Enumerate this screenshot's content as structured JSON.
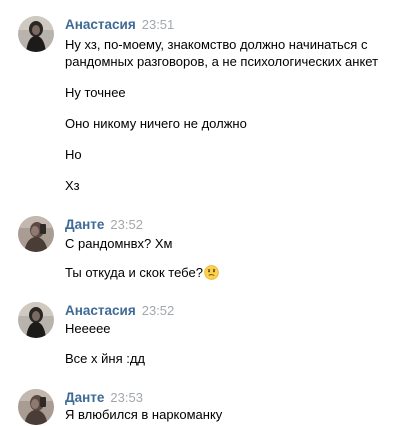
{
  "messages": [
    {
      "author": "Анастасия",
      "time": "23:51",
      "lines": [
        "Ну хз, по-моему, знакомство должно начинаться с",
        "рандомных разговоров, а не психологических анкет",
        "Ну точнее",
        "Оно никому ничего не должно",
        "Но",
        "Хз"
      ]
    },
    {
      "author": "Данте",
      "time": "23:52",
      "lines": [
        "С рандомнвх? Хм",
        "Ты откуда и скок тебе?"
      ],
      "emoji_icon": "confused-face-emoji-icon"
    },
    {
      "author": "Анастасия",
      "time": "23:52",
      "lines": [
        "Неееее",
        "Все х  йня :дд"
      ]
    },
    {
      "author": "Данте",
      "time": "23:53",
      "lines": [
        "Я влюбился в наркоманку"
      ]
    }
  ],
  "colors": {
    "author": "#3e6a96",
    "time": "#a3a8ad",
    "text": "#000000"
  }
}
